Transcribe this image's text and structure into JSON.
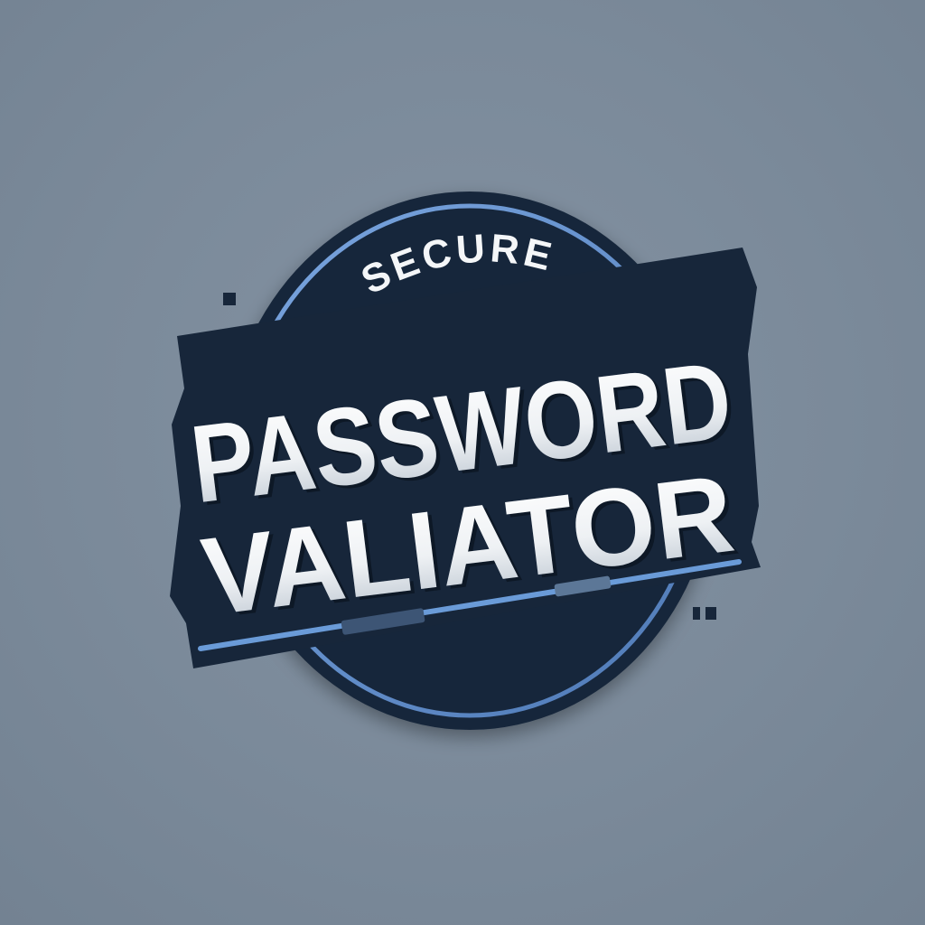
{
  "logo": {
    "top_word": "SECURE",
    "line1": "PASSWORD",
    "line2": "VALIATOR"
  },
  "colors": {
    "background": "#7d8c9c",
    "badge_dark": "#17263a",
    "ring_blue": "#5f8fcb",
    "text_light": "#f2f4f6",
    "text_shadow": "#2a3a52"
  }
}
